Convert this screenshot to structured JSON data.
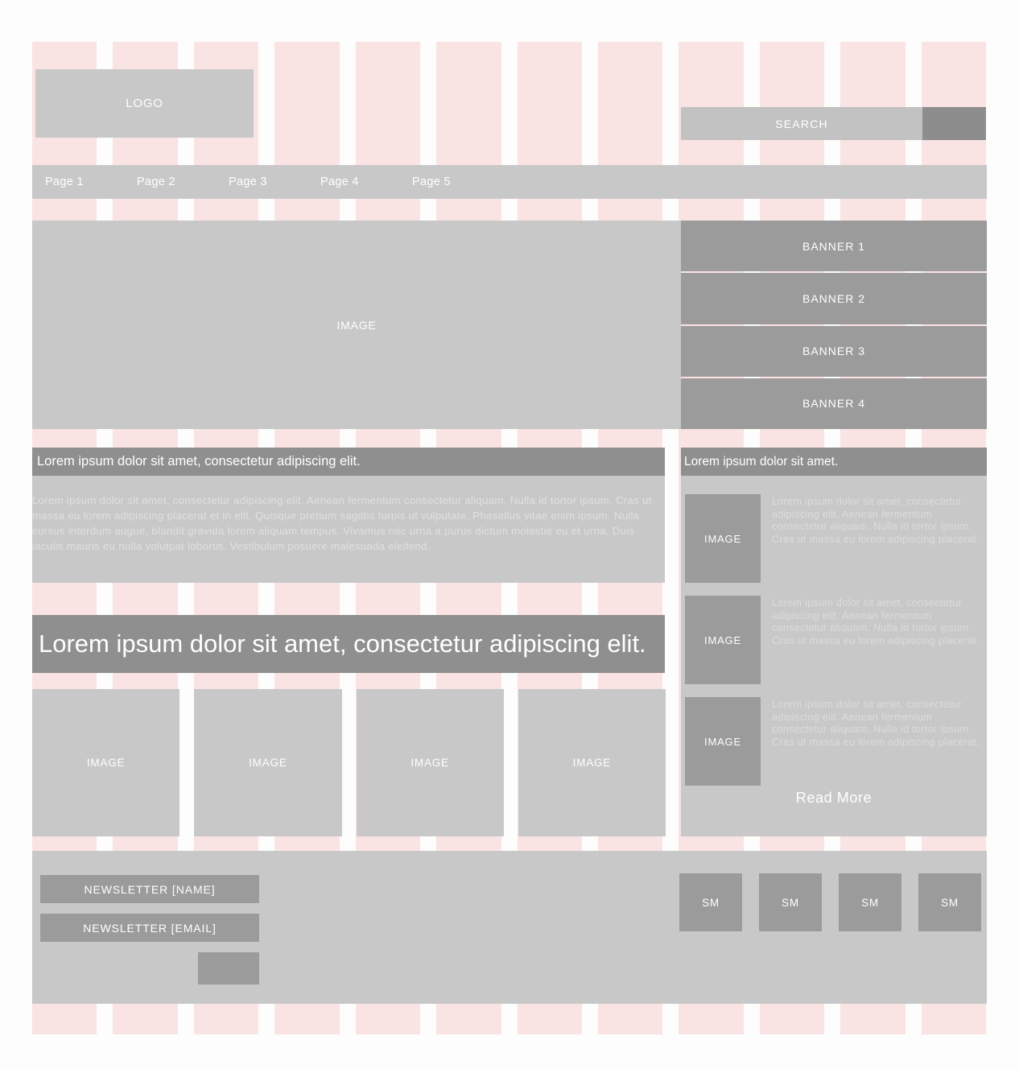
{
  "colors": {
    "grid_pink": "#fae3e3",
    "placeholder_light": "#c8c8c8",
    "placeholder_mid": "#9b9b9b",
    "placeholder_dark": "#8f8f8f",
    "page_background": "#fdfdfd",
    "text_on_grey": "#ffffff"
  },
  "header": {
    "logo_label": "LOGO",
    "search": {
      "placeholder": "SEARCH",
      "value": "",
      "button_label": ""
    }
  },
  "nav": {
    "items": [
      {
        "label": "Page 1"
      },
      {
        "label": "Page 2"
      },
      {
        "label": "Page 3"
      },
      {
        "label": "Page 4"
      },
      {
        "label": "Page 5"
      }
    ]
  },
  "hero": {
    "image_label": "IMAGE",
    "banners": [
      {
        "label": "BANNER 1"
      },
      {
        "label": "BANNER 2"
      },
      {
        "label": "BANNER 3"
      },
      {
        "label": "BANNER 4"
      }
    ]
  },
  "article": {
    "heading": "Lorem ipsum dolor sit amet, consectetur adipiscing elit.",
    "body": "Lorem ipsum dolor sit amet, consectetur adipiscing elit. Aenean fermentum consectetur aliquam. Nulla id tortor ipsum. Cras ut massa eu lorem adipiscing placerat et in elit. Quisque pretium sagittis turpis ut vulputate. Phasellus vitae enim ipsum. Nulla cursus interdum augue, blandit gravida lorem aliquam tempus. Vivamus nec urna a purus dictum molestie eu et urna. Duis iaculis mauris eu nulla volutpat lobortis. Vestibulum posuere malesuada eleifend."
  },
  "headline": {
    "text": "Lorem ipsum dolor sit amet, consectetur adipiscing elit."
  },
  "thumbnails": [
    {
      "label": "IMAGE"
    },
    {
      "label": "IMAGE"
    },
    {
      "label": "IMAGE"
    },
    {
      "label": "IMAGE"
    }
  ],
  "sidebar": {
    "heading": "Lorem ipsum dolor sit amet.",
    "items": [
      {
        "image_label": "IMAGE",
        "text": "Lorem ipsum dolor sit amet, consectetur adipiscing elit. Aenean fermentum consectetur aliquam. Nulla id tortor ipsum. Cras ut massa eu lorem adipiscing placerat."
      },
      {
        "image_label": "IMAGE",
        "text": "Lorem ipsum dolor sit amet, consectetur adipiscing elit. Aenean fermentum consectetur aliquam. Nulla id tortor ipsum. Cras ut massa eu lorem adipiscing placerat."
      },
      {
        "image_label": "IMAGE",
        "text": "Lorem ipsum dolor sit amet, consectetur adipiscing elit. Aenean fermentum consectetur aliquam. Nulla id tortor ipsum. Cras ut massa eu lorem adipiscing placerat."
      }
    ],
    "read_more_label": "Read More"
  },
  "footer": {
    "newsletter_name": {
      "placeholder": "NEWSLETTER [NAME]",
      "value": ""
    },
    "newsletter_email": {
      "placeholder": "NEWSLETTER [EMAIL]",
      "value": ""
    },
    "submit_label": "",
    "social": [
      {
        "label": "SM"
      },
      {
        "label": "SM"
      },
      {
        "label": "SM"
      },
      {
        "label": "SM"
      }
    ]
  },
  "grid": {
    "columns": 12
  }
}
